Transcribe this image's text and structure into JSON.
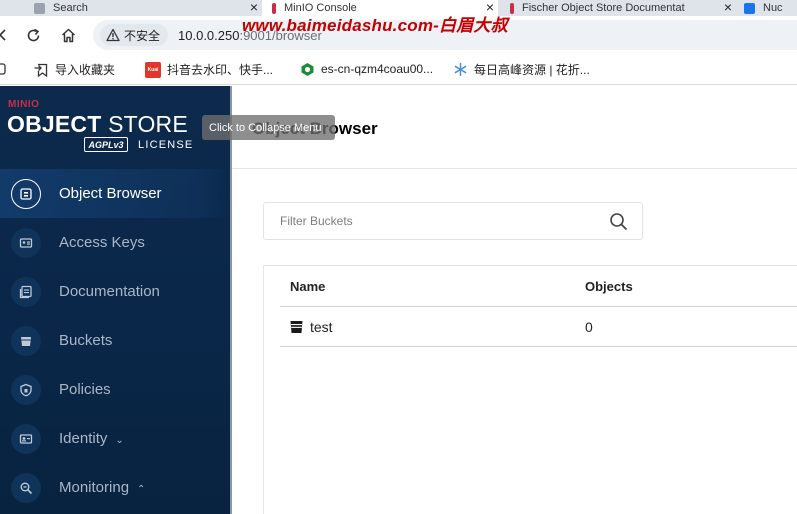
{
  "browser": {
    "tabs": [
      {
        "title": "Search"
      },
      {
        "title": "MinIO Console"
      },
      {
        "title": "Fischer Object Store Documentat"
      },
      {
        "title": "Nuc"
      }
    ],
    "watermark": "www.baimeidashu.com-白眉大叔",
    "security_label": "不安全",
    "url_host": "10.0.0.250",
    "url_rest": ":9001/browser",
    "bookmarks": [
      {
        "label": "导入收藏夹"
      },
      {
        "label": "抖音去水印、快手..."
      },
      {
        "label": "es-cn-qzm4coau00..."
      },
      {
        "label": "每日高峰资源 | 花折..."
      }
    ],
    "kuai_badge": "Kuai"
  },
  "sidebar": {
    "brand_small": "MINIO",
    "brand_bold": "OBJECT",
    "brand_light": "STORE",
    "license_badge": "AGPLv3",
    "license_label": "LICENSE",
    "items": [
      {
        "label": "Object Browser",
        "icon": "object-browser-icon",
        "active": true
      },
      {
        "label": "Access Keys",
        "icon": "access-keys-icon"
      },
      {
        "label": "Documentation",
        "icon": "documentation-icon"
      },
      {
        "label": "Buckets",
        "icon": "buckets-icon"
      },
      {
        "label": "Policies",
        "icon": "policies-icon"
      },
      {
        "label": "Identity",
        "icon": "identity-icon",
        "chevron": "down"
      },
      {
        "label": "Monitoring",
        "icon": "monitoring-icon",
        "chevron": "up"
      }
    ]
  },
  "main": {
    "title": "Object Browser",
    "tooltip": "Click to Collapse Menu",
    "filter_placeholder": "Filter Buckets",
    "table": {
      "columns": [
        "Name",
        "Objects"
      ],
      "rows": [
        {
          "name": "test",
          "objects": "0"
        }
      ]
    }
  },
  "colors": {
    "sidebar_bg": "#0d2a4d",
    "brand_red": "#c72e49",
    "watermark_red": "#c40000"
  }
}
